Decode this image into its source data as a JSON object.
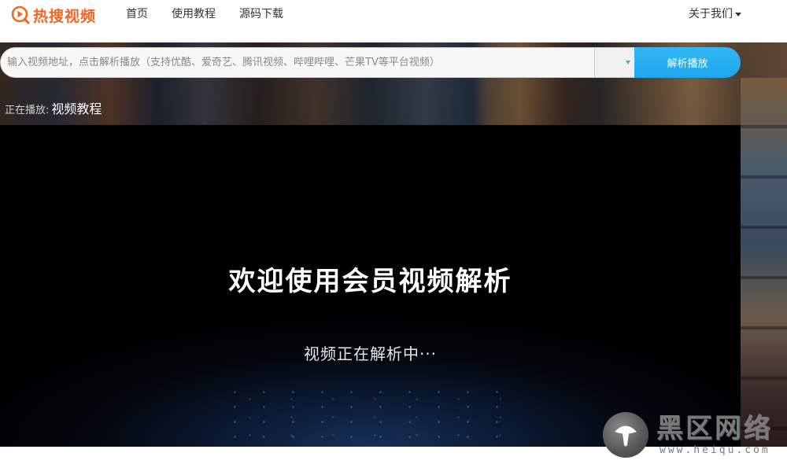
{
  "brand": {
    "name": "热搜视频",
    "icon": "play-search-icon",
    "color": "#f26522"
  },
  "nav": {
    "items": [
      {
        "label": "首页"
      },
      {
        "label": "使用教程"
      },
      {
        "label": "源码下载"
      }
    ]
  },
  "about": {
    "label": "关于我们",
    "icon": "caret-down-icon"
  },
  "search": {
    "value": "",
    "placeholder": "输入视频地址，点击解析播放（支持优酷、爱奇艺、腾讯视频、哔哩哔哩、芒果TV等平台视频）",
    "source_value": "",
    "button_label": "解析播放",
    "button_color": "#1ea6ec"
  },
  "now_playing": {
    "prefix": "正在播放:",
    "title": "视频教程"
  },
  "player": {
    "welcome": "欢迎使用会员视频解析",
    "status": "视频正在解析中···"
  },
  "watermark": {
    "title": "黑区网络",
    "url": "www.heiqu.com"
  }
}
